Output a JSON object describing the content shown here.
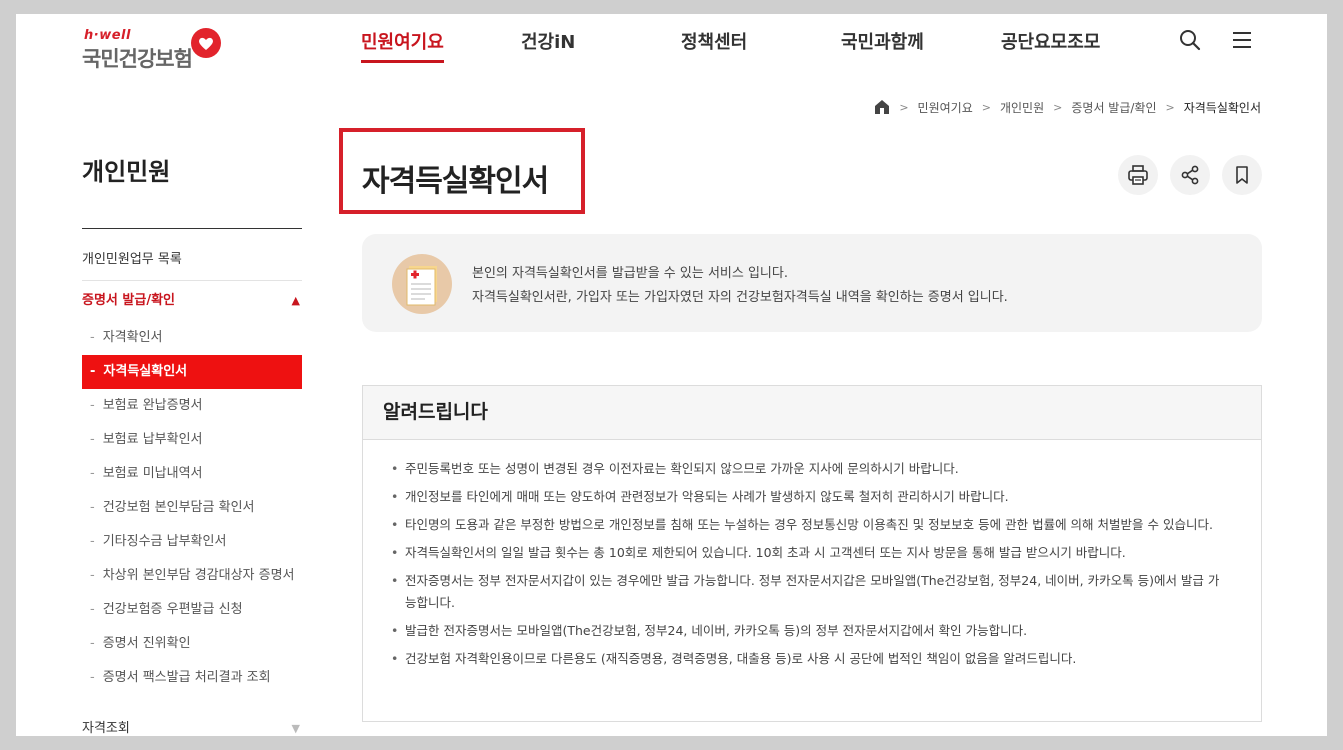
{
  "header": {
    "logo_small": "h·well",
    "logo_main": "국민건강보험",
    "nav": [
      {
        "label": "민원여기요",
        "active": true
      },
      {
        "label": "건강iN",
        "active": false
      },
      {
        "label": "정책센터",
        "active": false
      },
      {
        "label": "국민과함께",
        "active": false
      },
      {
        "label": "공단요모조모",
        "active": false
      }
    ],
    "icons": [
      "search-icon",
      "menu-icon"
    ]
  },
  "breadcrumb": {
    "items": [
      "민원여기요",
      "개인민원",
      "증명서 발급/확인"
    ],
    "current": "자격득실확인서"
  },
  "sidebar": {
    "title": "개인민원",
    "items": [
      {
        "label": "개인민원업무 목록"
      },
      {
        "label": "증명서 발급/확인",
        "open": true
      }
    ],
    "sub_items": [
      {
        "label": "자격확인서",
        "active": false
      },
      {
        "label": "자격득실확인서",
        "active": true
      },
      {
        "label": "보험료 완납증명서",
        "active": false
      },
      {
        "label": "보험료 납부확인서",
        "active": false
      },
      {
        "label": "보험료 미납내역서",
        "active": false
      },
      {
        "label": "건강보험 본인부담금 확인서",
        "active": false
      },
      {
        "label": "기타징수금 납부확인서",
        "active": false
      },
      {
        "label": "차상위 본인부담 경감대상자 증명서",
        "active": false
      },
      {
        "label": "건강보험증 우편발급 신청",
        "active": false
      },
      {
        "label": "증명서 진위확인",
        "active": false
      },
      {
        "label": "증명서 팩스발급 처리결과 조회",
        "active": false
      }
    ],
    "last_item": "자격조회",
    "arrow_up": "▲",
    "arrow_down": "▼"
  },
  "main": {
    "title": "자격득실확인서",
    "tools": [
      "print-icon",
      "share-icon",
      "bookmark-icon"
    ],
    "info_lines": [
      "본인의 자격득실확인서를 발급받을 수 있는 서비스 입니다.",
      "자격득실확인서란, 가입자 또는 가입자였던 자의 건강보험자격득실 내역을 확인하는 증명서 입니다."
    ],
    "notice_title": "알려드립니다",
    "notices": [
      "주민등록번호 또는 성명이 변경된 경우 이전자료는 확인되지 않으므로 가까운 지사에 문의하시기 바랍니다.",
      "개인정보를 타인에게 매매 또는 양도하여 관련정보가 악용되는 사례가 발생하지 않도록 철저히 관리하시기 바랍니다.",
      "타인명의 도용과 같은 부정한 방법으로 개인정보를 침해 또는 누설하는 경우 정보통신망 이용촉진 및 정보보호 등에 관한 법률에 의해 처벌받을 수 있습니다.",
      "자격득실확인서의 일일 발급 횟수는 총 10회로 제한되어 있습니다. 10회 초과 시 고객센터 또는 지사 방문을 통해 발급 받으시기 바랍니다.",
      "전자증명서는 정부 전자문서지갑이 있는 경우에만 발급 가능합니다. 정부 전자문서지갑은 모바일앱(The건강보험, 정부24, 네이버, 카카오톡 등)에서 발급 가능합니다.",
      "발급한 전자증명서는 모바일앱(The건강보험, 정부24, 네이버, 카카오톡 등)의 정부 전자문서지갑에서 확인 가능합니다.",
      "건강보험 자격확인용이므로 다른용도 (재직증명용, 경력증명용, 대출용 등)로 사용 시 공단에 법적인 책임이 없음을 알려드립니다."
    ]
  },
  "colors": {
    "brand_red": "#c8151e",
    "active_menu": "#ee1111",
    "highlight_border": "#d6202a"
  }
}
